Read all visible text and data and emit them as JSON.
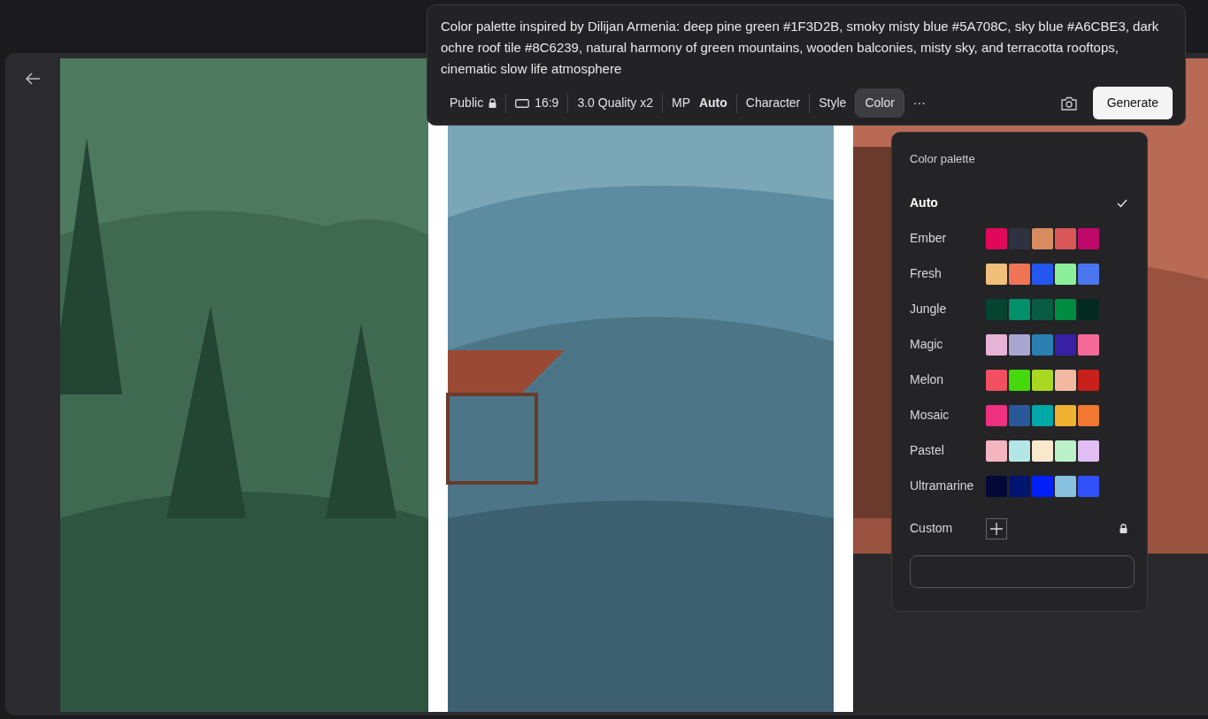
{
  "prompt": {
    "text": "Color palette inspired by Dilijan Armenia: deep pine green #1F3D2B, smoky misty blue #5A708C, sky blue #A6CBE3, dark ochre roof tile #8C6239, natural harmony of green mountains, wooden balconies, misty sky, and terracotta rooftops, cinematic slow life atmosphere"
  },
  "toolbar": {
    "items": [
      {
        "kind": "visibility",
        "label": "Public",
        "selected": false
      },
      {
        "kind": "ratio",
        "label": "16:9",
        "selected": false
      },
      {
        "kind": "plain",
        "label": "3.0 Quality x2",
        "selected": false
      },
      {
        "kind": "labeled",
        "label": "MP",
        "value": "Auto",
        "selected": false
      },
      {
        "kind": "plain",
        "label": "Character",
        "selected": false
      },
      {
        "kind": "plain",
        "label": "Style",
        "selected": false
      },
      {
        "kind": "plain",
        "label": "Color",
        "selected": true
      },
      {
        "kind": "more",
        "label": "···",
        "selected": false
      }
    ],
    "generate": "Generate"
  },
  "palette": {
    "title": "Color palette",
    "options": [
      {
        "name": "Auto",
        "selected": true
      },
      {
        "name": "Ember",
        "selected": false,
        "swatches": [
          {
            "color": "#e0085a"
          },
          {
            "color": "#2e3140"
          },
          {
            "color": "#d98c5f"
          },
          {
            "color": "#d95757"
          },
          {
            "color": "#c0086a"
          }
        ]
      },
      {
        "name": "Fresh",
        "selected": false,
        "swatches": [
          {
            "color": "#f0bf7a"
          },
          {
            "color": "#ef7455"
          },
          {
            "color": "#2456f0"
          },
          {
            "color": "#8cef9a"
          },
          {
            "color": "#4a76f0"
          }
        ]
      },
      {
        "name": "Jungle",
        "selected": false,
        "swatches": [
          {
            "color": "#064430"
          },
          {
            "color": "#00906a"
          },
          {
            "color": "#075c42"
          },
          {
            "color": "#008c40"
          },
          {
            "color": "#032a20"
          }
        ]
      },
      {
        "name": "Magic",
        "selected": false,
        "swatches": [
          {
            "color": "#e7b3d6"
          },
          {
            "color": "#aaa6d2"
          },
          {
            "color": "#2a7fb0"
          },
          {
            "color": "#3720a6"
          },
          {
            "color": "#f46b9a"
          }
        ]
      },
      {
        "name": "Melon",
        "selected": false,
        "swatches": [
          {
            "color": "#f05060"
          },
          {
            "color": "#45d80a"
          },
          {
            "color": "#a8d820"
          },
          {
            "color": "#f2b8a0"
          },
          {
            "color": "#c8201a"
          }
        ]
      },
      {
        "name": "Mosaic",
        "selected": false,
        "swatches": [
          {
            "color": "#f03080"
          },
          {
            "color": "#2a5898"
          },
          {
            "color": "#00a8a8"
          },
          {
            "color": "#f0b030"
          },
          {
            "color": "#f07830"
          }
        ]
      },
      {
        "name": "Pastel",
        "selected": false,
        "swatches": [
          {
            "color": "#f4b4c0"
          },
          {
            "color": "#b4e6e6"
          },
          {
            "color": "#f8e8cc"
          },
          {
            "color": "#bcf0c8"
          },
          {
            "color": "#e0bef4"
          }
        ]
      },
      {
        "name": "Ultramarine",
        "selected": false,
        "swatches": [
          {
            "color": "#040838"
          },
          {
            "color": "#001470"
          },
          {
            "color": "#0020f8"
          },
          {
            "color": "#88c0e0"
          },
          {
            "color": "#3050f8"
          }
        ]
      }
    ],
    "custom": {
      "label": "Custom"
    }
  }
}
